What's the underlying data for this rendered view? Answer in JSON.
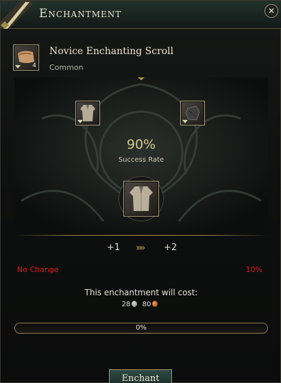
{
  "window": {
    "title": "Enchantment",
    "close_label": "✕"
  },
  "scroll": {
    "name": "Novice Enchanting Scroll",
    "rarity": "Common",
    "count": "4"
  },
  "enchant": {
    "success_rate": "90%",
    "success_label": "Success Rate",
    "level_from": "+1",
    "level_arrow": "»»",
    "level_to": "+2",
    "fail_result": "No Change",
    "fail_chance": "10%",
    "cost_label": "This enchantment will cost:",
    "cost_silver": "28",
    "cost_copper": "80"
  },
  "progress": {
    "value": 0,
    "label": "0%"
  },
  "actions": {
    "enchant_label": "Enchant"
  },
  "colors": {
    "accent_gold": "#b09a5a",
    "fail_red": "#e02020",
    "button_teal": "#2f4a44"
  }
}
